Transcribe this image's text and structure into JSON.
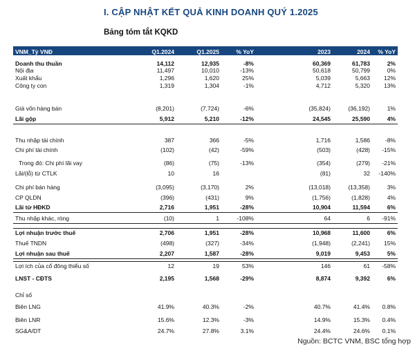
{
  "title": "I. CẬP NHẬT KẾT QUẢ KINH DOANH QUÝ 1.2025",
  "subtitle": "Bảng tóm tắt KQKD",
  "header": [
    "VNM_Tỷ VNĐ",
    "Q1.2024",
    "Q1.2025",
    "% YoY",
    "2023",
    "2024",
    "% YoY"
  ],
  "rows": [
    [
      "Doanh thu thuần",
      "14,112",
      "12,935",
      "-8%",
      "60,369",
      "61,783",
      "2%"
    ],
    [
      "Nội địa",
      "11,497",
      "10,010",
      "-13%",
      "50,618",
      "50,799",
      "0%"
    ],
    [
      "Xuất khẩu",
      "1,296",
      "1,620",
      "25%",
      "5,039",
      "5,663",
      "12%"
    ],
    [
      "Công ty con",
      "1,319",
      "1,304",
      "-1%",
      "4,712",
      "5,320",
      "13%"
    ],
    [
      "Giá vốn hàng bán",
      "(8,201)",
      "(7,724)",
      "-6%",
      "(35,824)",
      "(36,192)",
      "1%"
    ],
    [
      "Lãi gộp",
      "5,912",
      "5,210",
      "-12%",
      "24,545",
      "25,590",
      "4%"
    ],
    [
      "Thu nhập tài chính",
      "387",
      "366",
      "-5%",
      "1,716",
      "1,586",
      "-8%"
    ],
    [
      "Chi phí tài chính",
      "(102)",
      "(42)",
      "-59%",
      "(503)",
      "(428)",
      "-15%"
    ],
    [
      "Trong đó: Chi phí lãi vay",
      "(86)",
      "(75)",
      "-13%",
      "(354)",
      "(279)",
      "-21%"
    ],
    [
      "Lãi/(lỗ) từ CTLK",
      "10",
      "16",
      "",
      "(81)",
      "32",
      "-140%"
    ],
    [
      "Chi phí bán hàng",
      "(3,095)",
      "(3,170)",
      "2%",
      "(13,018)",
      "(13,358)",
      "3%"
    ],
    [
      "CP QLDN",
      "(396)",
      "(431)",
      "9%",
      "(1,756)",
      "(1,828)",
      "4%"
    ],
    [
      "Lãi từ HĐKD",
      "2,716",
      "1,951",
      "-28%",
      "10,904",
      "11,594",
      "6%"
    ],
    [
      "Thu nhập khác, ròng",
      "(10)",
      "1",
      "-108%",
      "64",
      "6",
      "-91%"
    ],
    [
      "Lợi nhuận trước thuế",
      "2,706",
      "1,951",
      "-28%",
      "10,968",
      "11,600",
      "6%"
    ],
    [
      "Thuế TNDN",
      "(498)",
      "(327)",
      "-34%",
      "(1,948)",
      "(2,241)",
      "15%"
    ],
    [
      "Lợi nhuận sau thuế",
      "2,207",
      "1,587",
      "-28%",
      "9,019",
      "9,453",
      "5%"
    ],
    [
      "Lợi ích của cổ đông thiểu số",
      "12",
      "19",
      "53%",
      "146",
      "61",
      "-58%"
    ],
    [
      "LNST - CĐTS",
      "2,195",
      "1,568",
      "-29%",
      "8,874",
      "9,392",
      "6%"
    ],
    [
      "Chỉ số",
      "",
      "",
      "",
      "",
      "",
      ""
    ],
    [
      "Biên LNG",
      "41.9%",
      "40.3%",
      "-2%",
      "40.7%",
      "41.4%",
      "0.8%"
    ],
    [
      "Biên LNR",
      "15.6%",
      "12.3%",
      "-3%",
      "14.9%",
      "15.3%",
      "0.4%"
    ],
    [
      "SG&A/DT",
      "24.7%",
      "27.8%",
      "3.1%",
      "24.4%",
      "24.6%",
      "0.1%"
    ]
  ],
  "source": "Nguồn: BCTC VNM, BSC tổng hợp",
  "colors": {
    "header_bg": "#17467e",
    "title": "#17467e"
  }
}
